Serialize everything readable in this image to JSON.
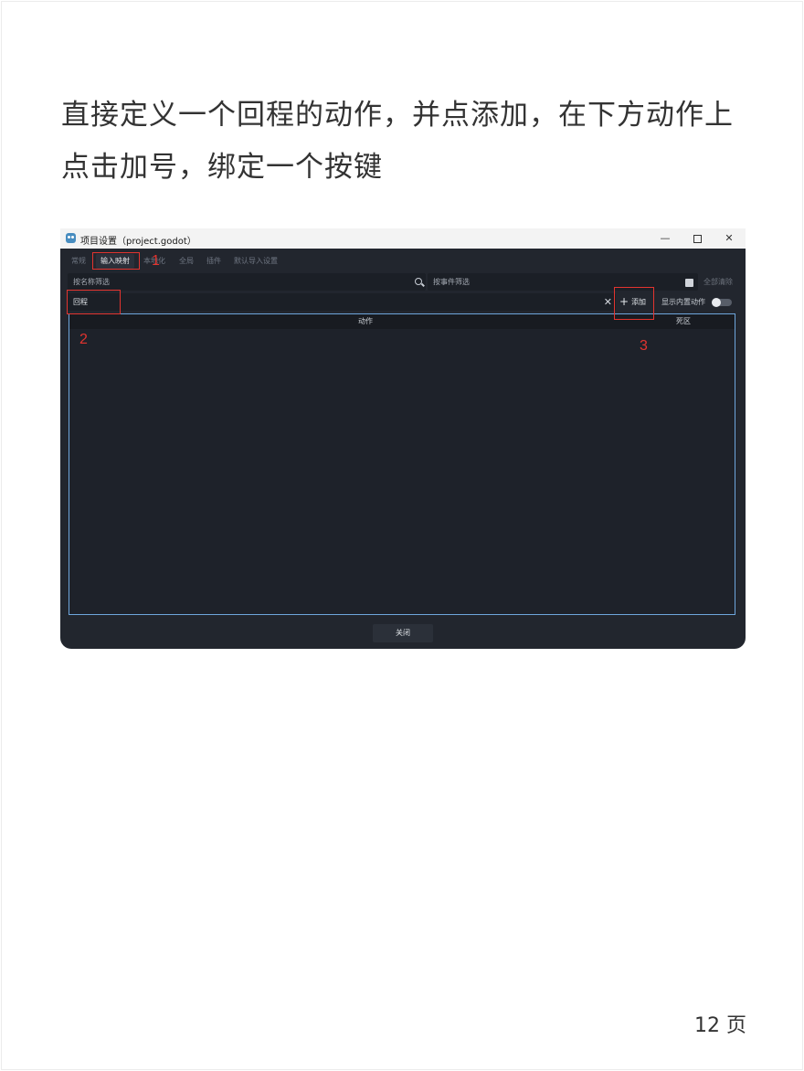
{
  "doc": {
    "heading_line1": "直接定义一个回程的动作，并点添加，在下方动作上",
    "heading_line2": "点击加号，绑定一个按键",
    "page_number": "12 页"
  },
  "window": {
    "title": "项目设置（project.godot）",
    "minimize": "—",
    "close": "✕"
  },
  "tabs": [
    {
      "label": "常规",
      "active": false
    },
    {
      "label": "输入映射",
      "active": true
    },
    {
      "label": "本地化",
      "active": false
    },
    {
      "label": "全局",
      "active": false
    },
    {
      "label": "插件",
      "active": false
    },
    {
      "label": "默认导入设置",
      "active": false
    }
  ],
  "filters": {
    "name_placeholder": "按名称筛选",
    "event_placeholder": "按事件筛选",
    "clear_all": "全部清除"
  },
  "action_input": {
    "value": "回程",
    "clear": "✕"
  },
  "add_button": {
    "label": "添加"
  },
  "show_builtin": {
    "label": "显示内置动作",
    "enabled": false
  },
  "columns": {
    "action": "动作",
    "deadzone": "死区"
  },
  "footer": {
    "close_label": "关闭"
  },
  "annotations": {
    "mark1": "1",
    "mark2": "2",
    "mark3": "3",
    "color": "#e3342f"
  },
  "colors": {
    "editor_bg": "#22262e",
    "focus_border": "#6ea6dc",
    "godot_blue": "#478cbf"
  }
}
